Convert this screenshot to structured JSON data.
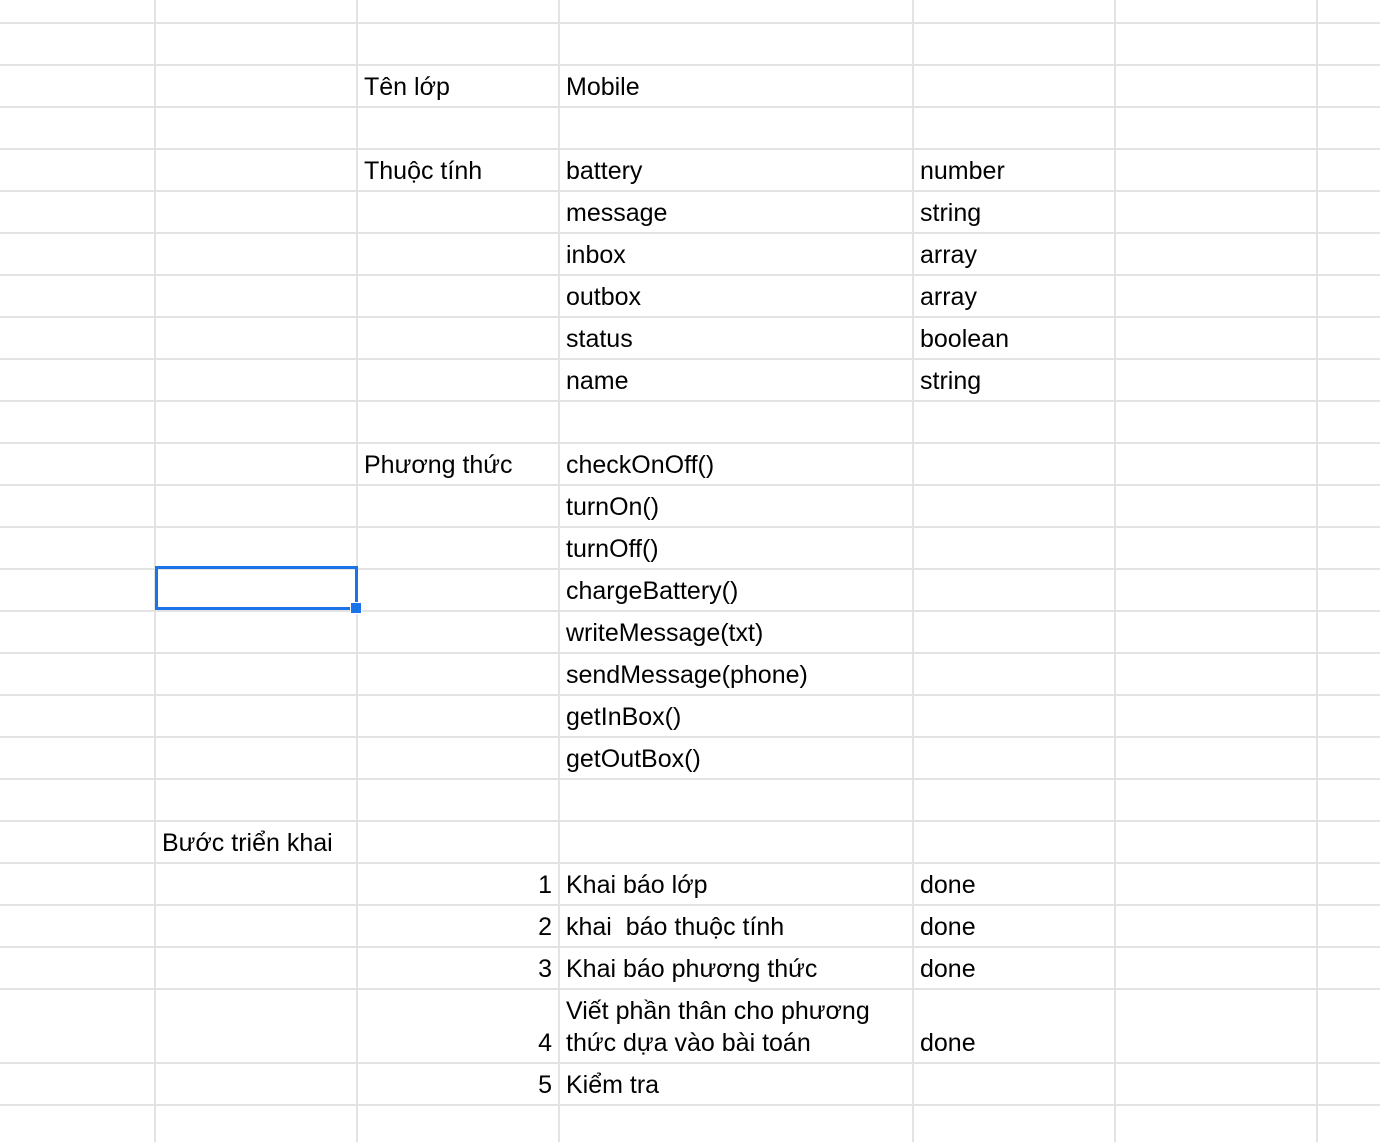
{
  "colors": {
    "gridline": "#e3e3e3",
    "selection": "#1a73e8"
  },
  "class_name_label": "Tên lớp",
  "class_name_value": "Mobile",
  "attributes_label": "Thuộc tính",
  "attributes": [
    {
      "name": "battery",
      "type": "number"
    },
    {
      "name": "message",
      "type": "string"
    },
    {
      "name": "inbox",
      "type": "array"
    },
    {
      "name": "outbox",
      "type": "array"
    },
    {
      "name": "status",
      "type": "boolean"
    },
    {
      "name": "name",
      "type": "string"
    }
  ],
  "methods_label": "Phương thức",
  "methods": [
    "checkOnOff()",
    "turnOn()",
    "turnOff()",
    "chargeBattery()",
    "writeMessage(txt)",
    "sendMessage(phone)",
    "getInBox()",
    "getOutBox()"
  ],
  "steps_label": "Bước triển khai",
  "steps": [
    {
      "number": "1",
      "description": "Khai báo lớp",
      "status": "done"
    },
    {
      "number": "2",
      "description": "khai  báo thuộc tính",
      "status": "done"
    },
    {
      "number": "3",
      "description": "Khai báo phương thức",
      "status": "done"
    },
    {
      "number": "4",
      "description": "Viết phần thân cho phương thức dựa vào bài toán",
      "status": "done"
    },
    {
      "number": "5",
      "description": "Kiểm tra",
      "status": ""
    }
  ]
}
